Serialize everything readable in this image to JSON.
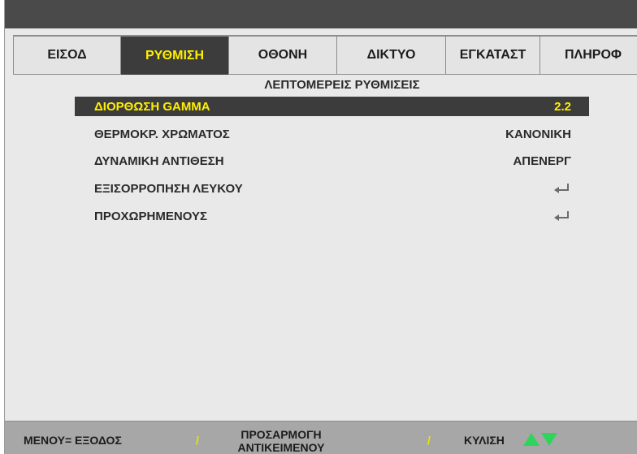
{
  "tabs": [
    {
      "label": "ΕΙΣΟΔ",
      "active": false
    },
    {
      "label": "ΡΥΘΜΙΣΗ",
      "active": true
    },
    {
      "label": "ΟΘΟΝΗ",
      "active": false
    },
    {
      "label": "ΔΙΚΤΥΟ",
      "active": false
    },
    {
      "label": "ΕΓΚΑΤΑΣΤ",
      "active": false
    },
    {
      "label": "ΠΛΗΡΟΦ",
      "active": false
    }
  ],
  "page_title": "ΛΕΠΤΟΜΕΡΕΙΣ ΡΥΘΜΙΣΕΙΣ",
  "menu_items": [
    {
      "label": "ΔΙΟΡΘΩΣΗ GAMMA",
      "value": "2.2",
      "selected": true
    },
    {
      "label": "ΘΕΡΜΟΚΡ. ΧΡΩΜΑΤΟΣ",
      "value": "ΚΑΝΟΝΙΚΗ",
      "selected": false
    },
    {
      "label": "ΔΥΝΑΜΙΚΗ ΑΝΤΙΘΕΣΗ",
      "value": "ΑΠΕΝΕΡΓ",
      "selected": false
    },
    {
      "label": "ΕΞΙΣΟΡΡΟΠΗΣΗ ΛΕΥΚΟΥ",
      "value_icon": "enter-icon",
      "selected": false
    },
    {
      "label": "ΠΡΟΧΩΡΗΜΕΝΟΥΣ",
      "value_icon": "enter-icon",
      "selected": false
    }
  ],
  "footer": {
    "menu_exit": "ΜΕΝΟΥ= ΕΞΟΔΟΣ",
    "separator": "/",
    "adjust_line1": "ΠΡΟΣΑΡΜΟΓΗ",
    "adjust_line2": "ΑΝΤΙΚΕΙΜΕΝΟΥ",
    "scroll": "ΚΥΛΙΣΗ",
    "scroll_icons": [
      "arrow-up-icon",
      "arrow-down-icon"
    ]
  },
  "colors": {
    "highlight_text": "#ffef00",
    "highlight_bg": "#3c3c3c",
    "arrow_green": "#2fd45a"
  }
}
